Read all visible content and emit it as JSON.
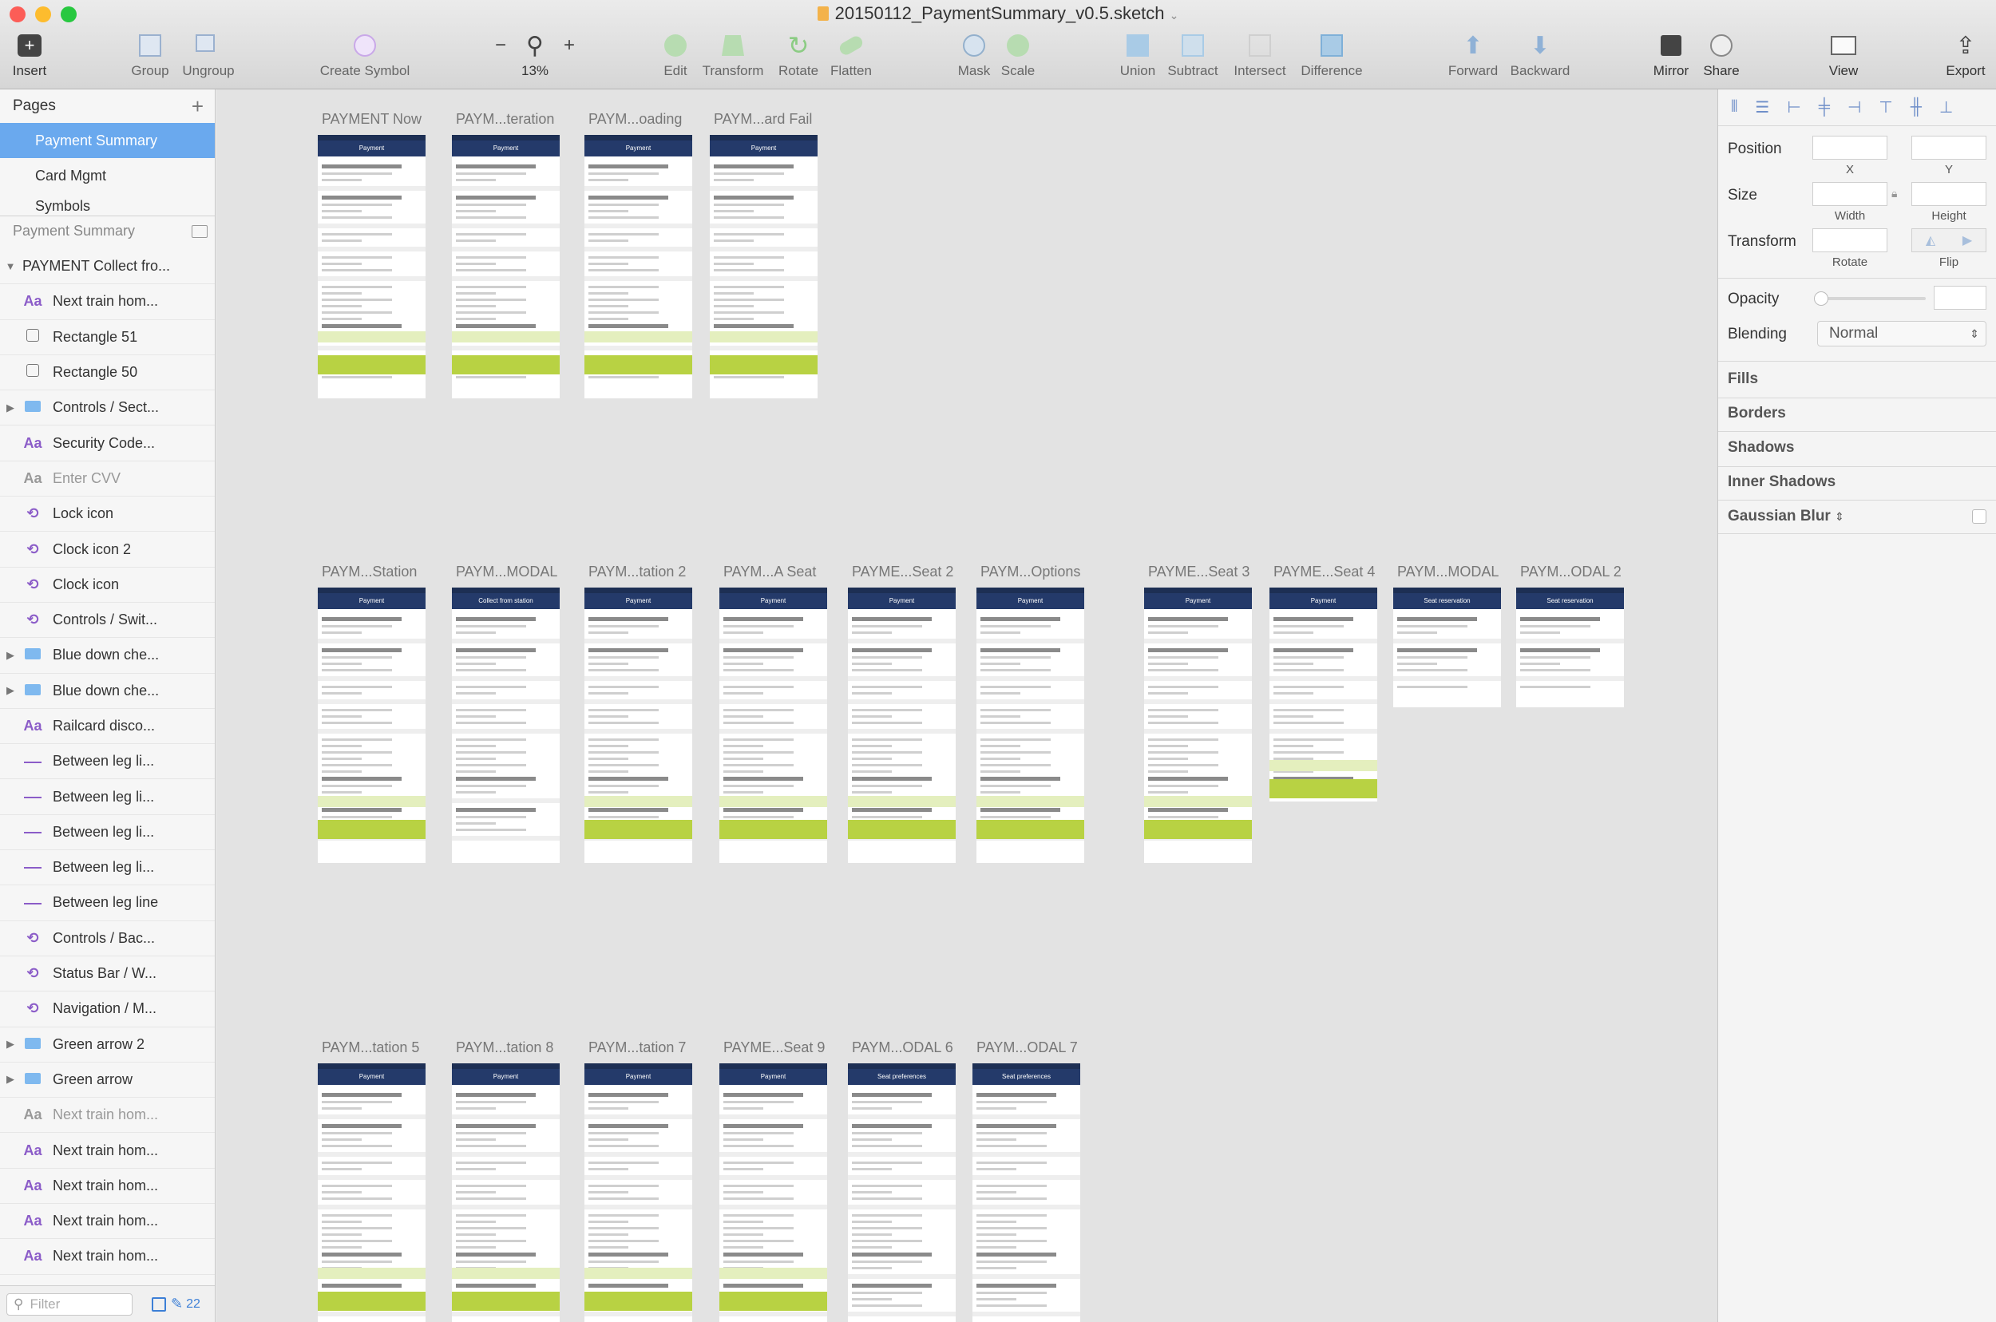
{
  "window": {
    "title": "20150112_PaymentSummary_v0.5.sketch",
    "traffic_colors": [
      "#fc5d57",
      "#fdbc2e",
      "#28c840"
    ]
  },
  "toolbar": {
    "insert": "Insert",
    "group": "Group",
    "ungroup": "Ungroup",
    "create_symbol": "Create Symbol",
    "zoom_minus": "−",
    "zoom_plus": "+",
    "zoom_value": "13%",
    "edit": "Edit",
    "transform": "Transform",
    "rotate": "Rotate",
    "flatten": "Flatten",
    "mask": "Mask",
    "scale": "Scale",
    "union": "Union",
    "subtract": "Subtract",
    "intersect": "Intersect",
    "difference": "Difference",
    "forward": "Forward",
    "backward": "Backward",
    "mirror": "Mirror",
    "share": "Share",
    "view": "View",
    "export": "Export"
  },
  "pages": {
    "header": "Pages",
    "add": "+",
    "items": [
      "Payment Summary",
      "Card Mgmt",
      "Symbols"
    ]
  },
  "layers": {
    "header": "Payment Summary",
    "items": [
      {
        "icon": "▾",
        "label": "PAYMENT Collect fro...",
        "type": "artboard"
      },
      {
        "icon": "Aa",
        "label": "Next train hom...",
        "type": "text"
      },
      {
        "icon": "☐",
        "label": "Rectangle 51",
        "type": "shape"
      },
      {
        "icon": "☐",
        "label": "Rectangle 50",
        "type": "shape"
      },
      {
        "icon": "folder",
        "label": "Controls / Sect...",
        "type": "group"
      },
      {
        "icon": "Aa",
        "label": "Security Code...",
        "type": "text"
      },
      {
        "icon": "Aa",
        "label": "Enter CVV",
        "type": "text-dim"
      },
      {
        "icon": "symbol",
        "label": "Lock icon",
        "type": "symbol"
      },
      {
        "icon": "symbol",
        "label": "Clock icon 2",
        "type": "symbol"
      },
      {
        "icon": "symbol",
        "label": "Clock icon",
        "type": "symbol"
      },
      {
        "icon": "symbol",
        "label": "Controls / Swit...",
        "type": "symbol"
      },
      {
        "icon": "folder",
        "label": "Blue down che...",
        "type": "group"
      },
      {
        "icon": "folder",
        "label": "Blue down che...",
        "type": "group"
      },
      {
        "icon": "Aa",
        "label": "Railcard disco...",
        "type": "text"
      },
      {
        "icon": "line",
        "label": "Between leg li...",
        "type": "line"
      },
      {
        "icon": "line",
        "label": "Between leg li...",
        "type": "line"
      },
      {
        "icon": "line",
        "label": "Between leg li...",
        "type": "line"
      },
      {
        "icon": "line",
        "label": "Between leg li...",
        "type": "line"
      },
      {
        "icon": "line",
        "label": "Between leg line",
        "type": "line"
      },
      {
        "icon": "symbol",
        "label": "Controls / Bac...",
        "type": "symbol"
      },
      {
        "icon": "symbol",
        "label": "Status Bar / W...",
        "type": "symbol"
      },
      {
        "icon": "symbol",
        "label": "Navigation / M...",
        "type": "symbol"
      },
      {
        "icon": "folder",
        "label": "Green arrow 2",
        "type": "group"
      },
      {
        "icon": "folder",
        "label": "Green arrow",
        "type": "group"
      },
      {
        "icon": "Aa",
        "label": "Next train hom...",
        "type": "text-dim"
      },
      {
        "icon": "Aa",
        "label": "Next train hom...",
        "type": "text"
      },
      {
        "icon": "Aa",
        "label": "Next train hom...",
        "type": "text"
      },
      {
        "icon": "Aa",
        "label": "Next train hom...",
        "type": "text"
      },
      {
        "icon": "Aa",
        "label": "Next train hom...",
        "type": "text"
      }
    ],
    "filter_placeholder": "Filter",
    "count": "22"
  },
  "artboards": [
    {
      "title": "PAYMENT Now",
      "header": "Payment"
    },
    {
      "title": "PAYM...teration",
      "header": "Payment"
    },
    {
      "title": "PAYM...oading",
      "header": "Payment"
    },
    {
      "title": "PAYM...ard Fail",
      "header": "Payment"
    },
    {
      "title": "PAYM...Station",
      "header": "Payment"
    },
    {
      "title": "PAYM...MODAL",
      "header": "Collect from station"
    },
    {
      "title": "PAYM...tation 2",
      "header": "Payment"
    },
    {
      "title": "PAYM...A Seat",
      "header": "Payment"
    },
    {
      "title": "PAYME...Seat 2",
      "header": "Payment"
    },
    {
      "title": "PAYM...Options",
      "header": "Payment"
    },
    {
      "title": "PAYME...Seat 3",
      "header": "Payment"
    },
    {
      "title": "PAYME...Seat 4",
      "header": "Payment"
    },
    {
      "title": "PAYM...MODAL",
      "header": "Seat reservation"
    },
    {
      "title": "PAYM...ODAL 2",
      "header": "Seat reservation"
    },
    {
      "title": "PAYM...tation 5",
      "header": "Payment"
    },
    {
      "title": "PAYM...tation 8",
      "header": "Payment"
    },
    {
      "title": "PAYM...tation 7",
      "header": "Payment"
    },
    {
      "title": "PAYME...Seat 9",
      "header": "Payment"
    },
    {
      "title": "PAYM...ODAL 6",
      "header": "Seat preferences"
    },
    {
      "title": "PAYM...ODAL 7",
      "header": "Seat preferences"
    }
  ],
  "inspector": {
    "position": "Position",
    "x": "X",
    "y": "Y",
    "size": "Size",
    "width": "Width",
    "height": "Height",
    "transform": "Transform",
    "rotate": "Rotate",
    "flip": "Flip",
    "opacity": "Opacity",
    "blending": "Blending",
    "blending_value": "Normal",
    "fills": "Fills",
    "borders": "Borders",
    "shadows": "Shadows",
    "inner_shadows": "Inner Shadows",
    "gaussian_blur": "Gaussian Blur"
  },
  "colors": {
    "accent": "#6aa9ee",
    "artboard_nav": "#243a6a",
    "buy_button": "#b8d243"
  }
}
